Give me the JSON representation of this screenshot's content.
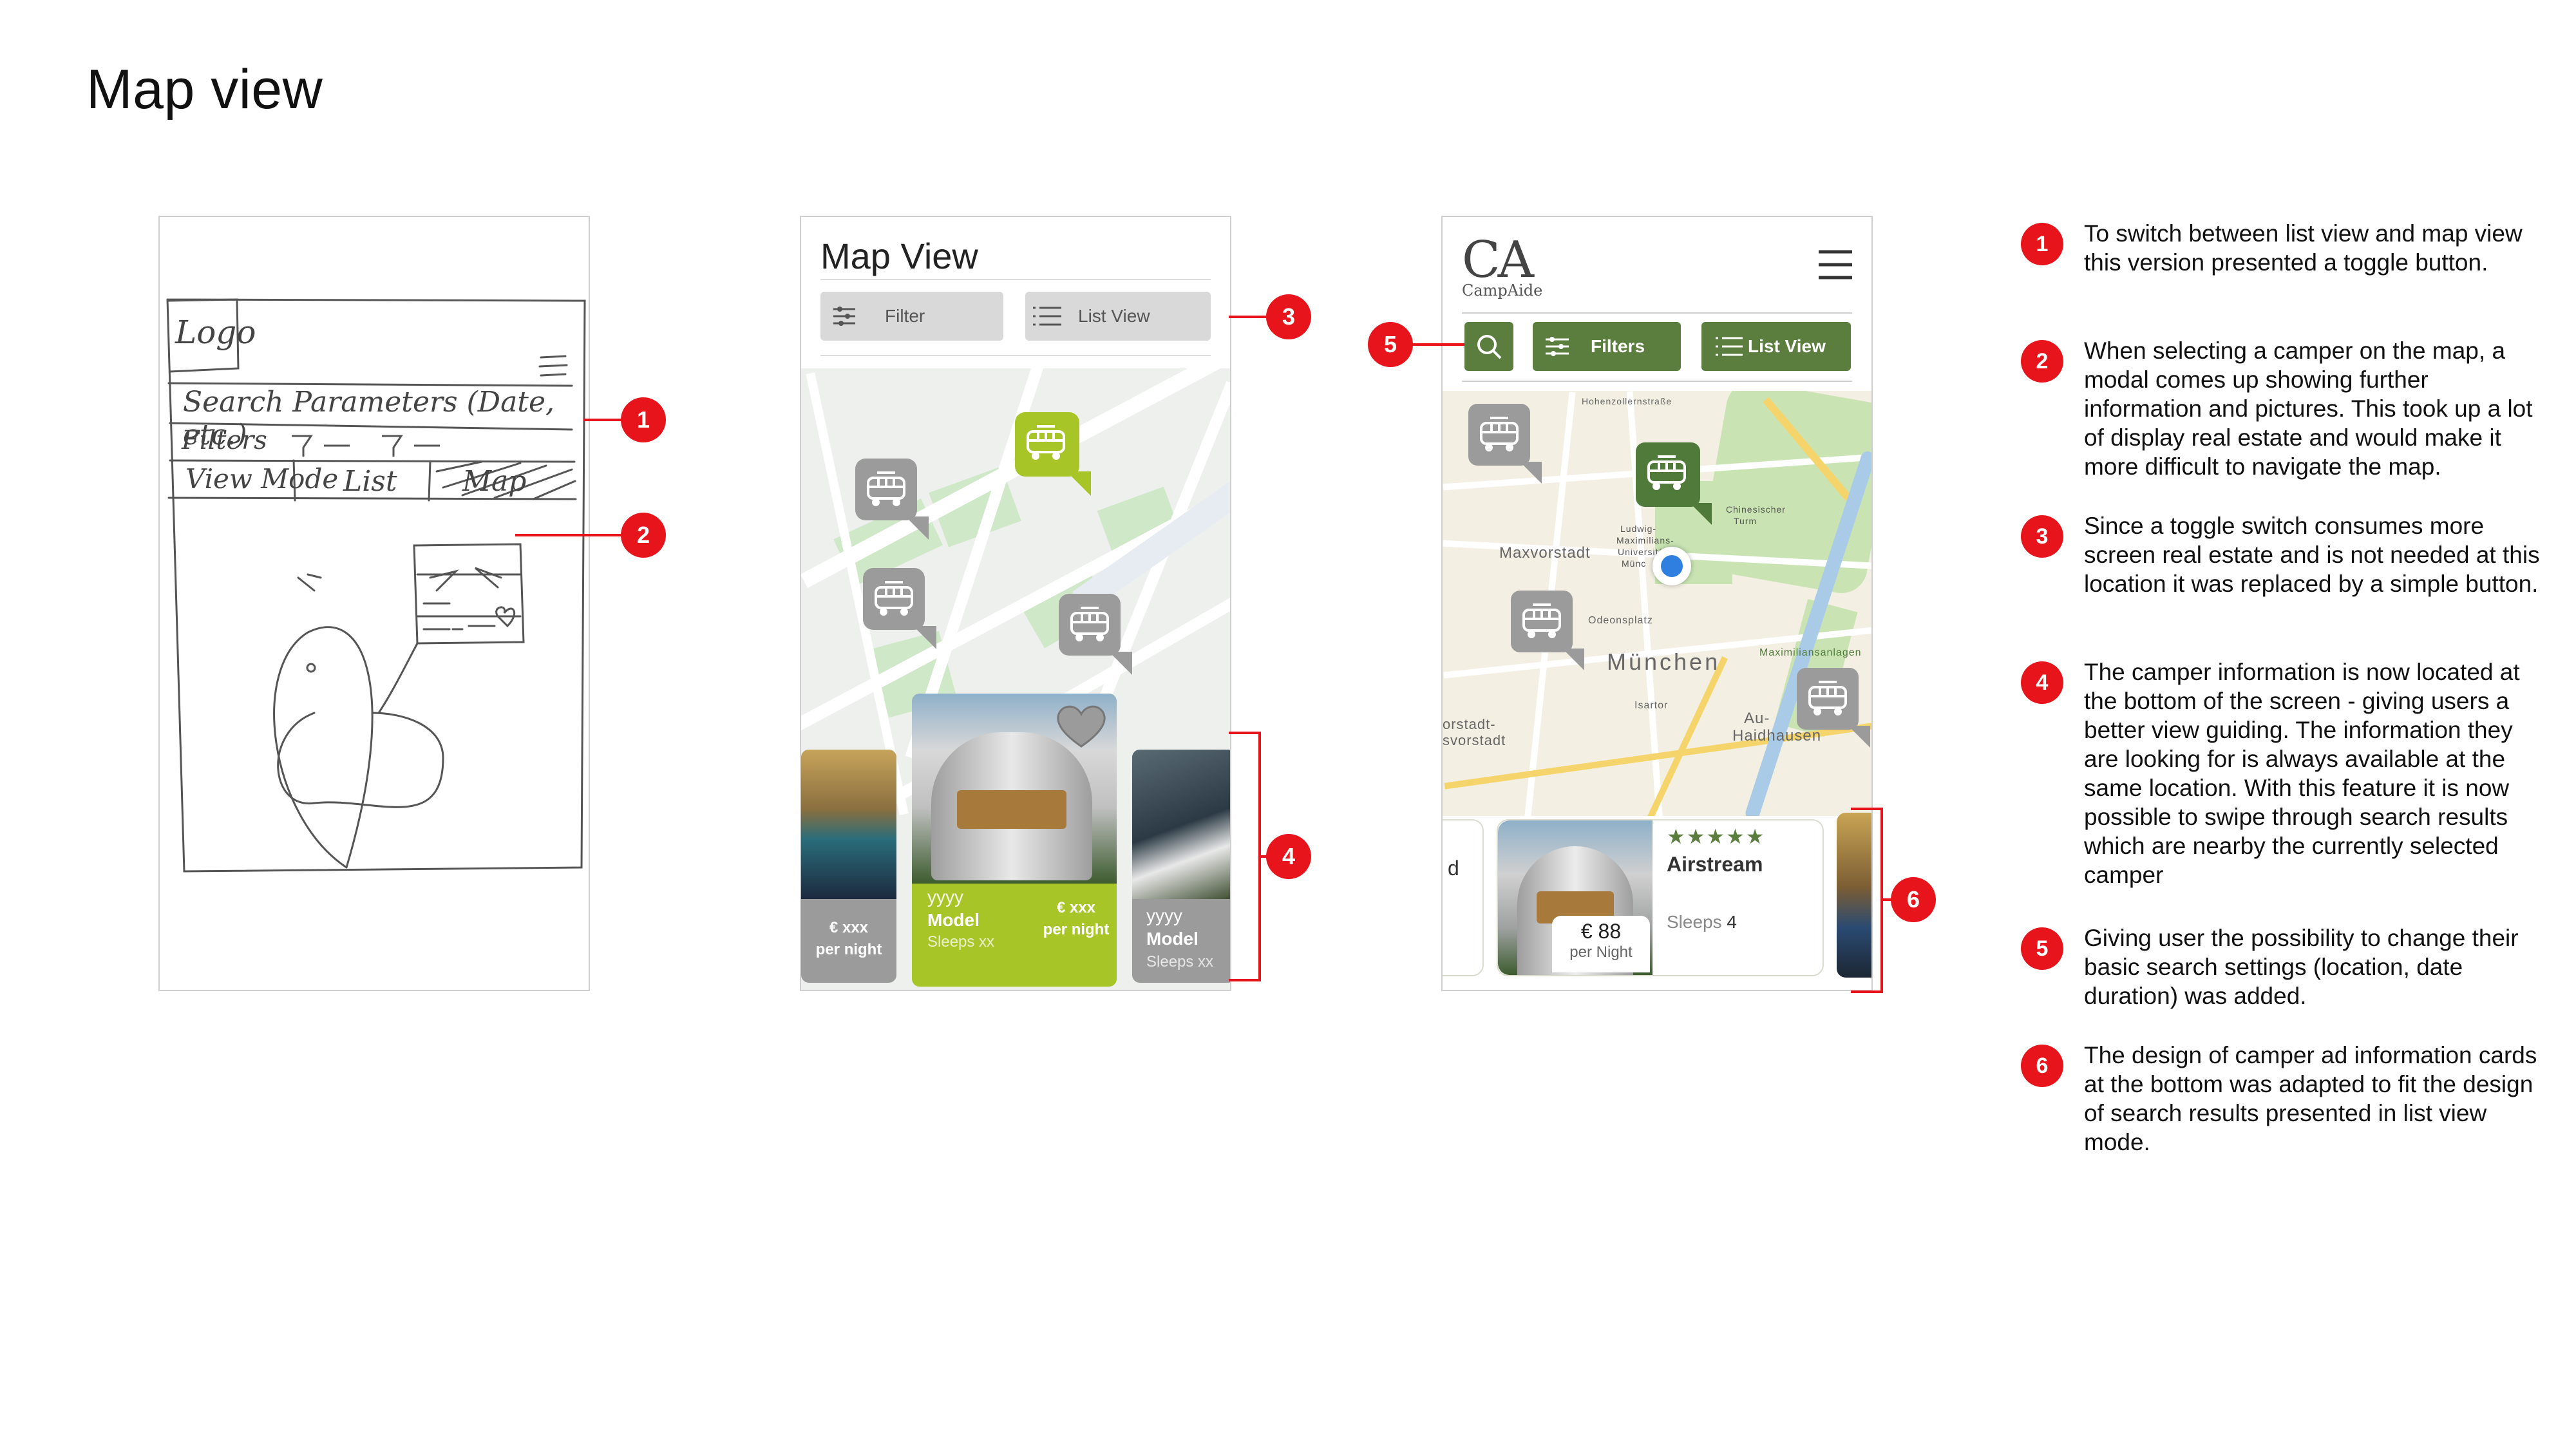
{
  "page_title": "Map view",
  "sketch": {
    "logo": "Logo",
    "search": "Search Parameters (Date, etc.)",
    "filters": "Filters",
    "view_mode": "View Mode",
    "list": "List",
    "map": "Map"
  },
  "wireframe": {
    "title": "Map View",
    "filter_label": "Filter",
    "list_view_label": "List View",
    "cards": [
      {
        "price": "€ xxx",
        "per": "per night"
      },
      {
        "year": "yyyy",
        "model": "Model",
        "sleeps": "Sleeps xx",
        "price": "€ xxx",
        "per": "per night"
      },
      {
        "year": "yyyy",
        "model": "Model",
        "sleeps": "Sleeps xx"
      }
    ]
  },
  "final": {
    "logo": "CA",
    "brand": "CampAide",
    "filters_label": "Filters",
    "list_view_label": "List View",
    "map_labels": {
      "maxvorstadt": "Maxvorstadt",
      "munchen": "München",
      "odeonsplatz": "Odeonsplatz",
      "au": "Au-",
      "haidhausen": "Haidhausen",
      "isartor": "Isartor",
      "maximiliansanlagen": "Maximiliansanlagen",
      "ludwig": "Ludwig-",
      "maximilians": "Maximilians-",
      "univ": "Universität",
      "munc": "Münc",
      "chinesischer": "Chinesischer",
      "turm": "Turm",
      "vorstadt": "orstadt-",
      "svorstadt": "svorstadt",
      "hohenzollern": "Hohenzollernstraße"
    },
    "card": {
      "left_char": "d",
      "stars": "★★★★★",
      "name": "Airstream",
      "price": "€ 88",
      "per": "per Night",
      "sleeps_label": "Sleeps",
      "sleeps_value": "4"
    }
  },
  "notes": [
    {
      "n": "1",
      "text": "To switch between list view and map view this version presented a toggle button."
    },
    {
      "n": "2",
      "text": "When selecting a camper on the map, a modal comes up showing further information and pictures. This took up a lot of display real estate and would make it more difficult to navigate the map."
    },
    {
      "n": "3",
      "text": "Since a toggle switch consumes more screen real estate and is not needed at this location it was replaced by a simple button."
    },
    {
      "n": "4",
      "text": "The camper information is now located at the bottom of the screen - giving users a better view guiding. The information they are looking for is always available at the same location. With this feature it is now possible to swipe through search results which are nearby the currently selected camper"
    },
    {
      "n": "5",
      "text": "Giving user the possibility to change their basic search settings (location, date duration) was added."
    },
    {
      "n": "6",
      "text": "The design of camper ad information cards at the bottom was adapted to fit the design of search results presented in list view mode."
    }
  ],
  "colors": {
    "accent_red": "#e8141c",
    "wire_green": "#a8c528",
    "final_green": "#5b7d3e"
  }
}
